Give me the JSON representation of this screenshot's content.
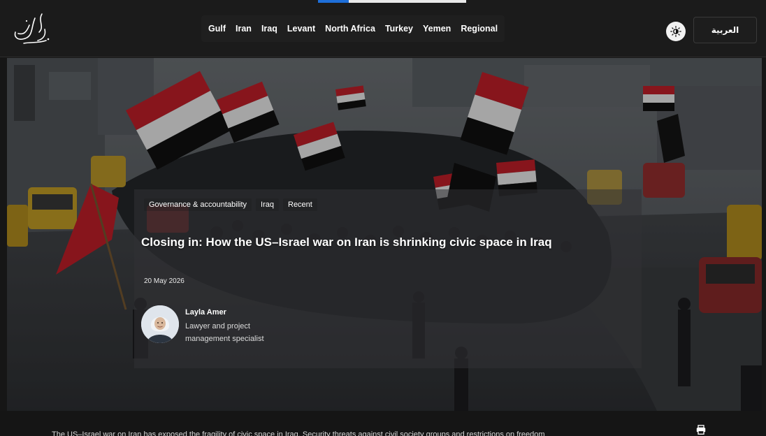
{
  "header": {
    "logo_icon": "calligraphy-logo-icon",
    "nav": [
      "Gulf",
      "Iran",
      "Iraq",
      "Levant",
      "North Africa",
      "Turkey",
      "Yemen",
      "Regional"
    ],
    "theme_icon": "brightness-icon",
    "language_label": "العربية"
  },
  "article": {
    "tags": [
      "Governance & accountability",
      "Iraq",
      "Recent"
    ],
    "title": "Closing in: How the US–Israel war on Iran is shrinking civic space in Iraq",
    "date": "20 May 2026",
    "author": {
      "name": "Layla Amer",
      "title": "Lawyer and project management specialist"
    },
    "summary": "The US–Israel war on Iran has exposed the fragility of civic space in Iraq. Security threats against civil society groups and restrictions on freedom",
    "print_icon": "print-icon"
  },
  "colors": {
    "background": "#1b1b1b",
    "accent": "#1e6fd9",
    "flag_red": "#c8202a",
    "flag_white": "#f4f4f4",
    "flag_black": "#111111",
    "tuktuk_yellow": "#c9a227"
  }
}
